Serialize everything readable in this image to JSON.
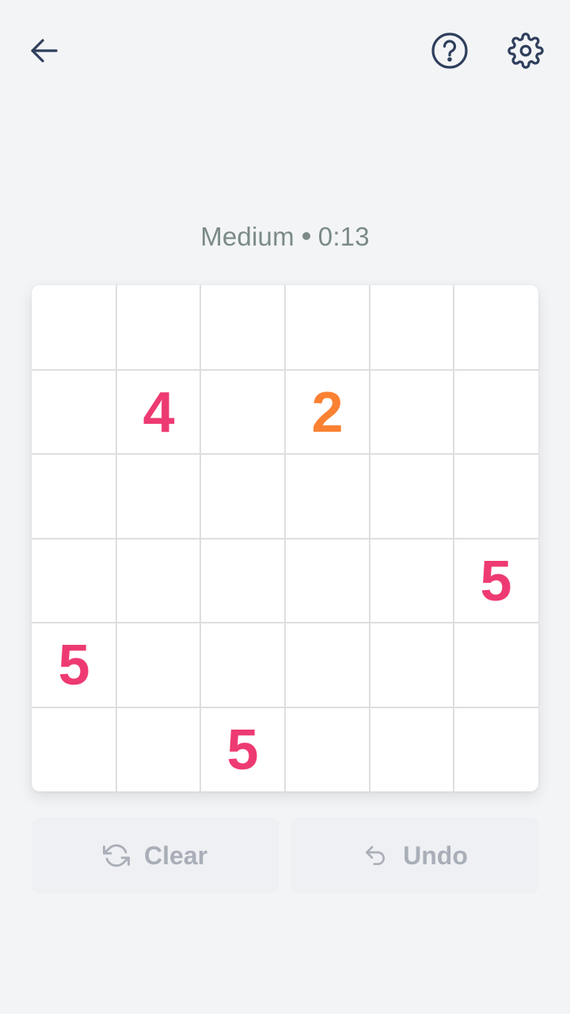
{
  "header": {
    "back_icon": "arrow-left-icon",
    "help_icon": "question-circle-icon",
    "settings_icon": "gear-icon"
  },
  "status": {
    "difficulty": "Medium",
    "time": "0:13"
  },
  "board": {
    "rows": 6,
    "cols": 6,
    "cells": [
      [
        "",
        "",
        "",
        "",
        "",
        ""
      ],
      [
        "",
        "4",
        "",
        "2",
        "",
        ""
      ],
      [
        "",
        "",
        "",
        "",
        "",
        ""
      ],
      [
        "",
        "",
        "",
        "",
        "",
        "5"
      ],
      [
        "5",
        "",
        "",
        "",
        "",
        ""
      ],
      [
        "",
        "",
        "5",
        "",
        "",
        ""
      ]
    ],
    "colors": {
      "4": "#ee3a72",
      "2": "#fb8132",
      "5": "#ee3a72"
    }
  },
  "actions": {
    "clear_label": "Clear",
    "undo_label": "Undo",
    "clear_icon": "refresh-icon",
    "undo_icon": "undo-arrow-icon"
  },
  "colors": {
    "background": "#f3f4f6",
    "icon": "#2f3f5c",
    "status_text": "#7b8a88",
    "disabled_text": "#a9aeb8"
  }
}
